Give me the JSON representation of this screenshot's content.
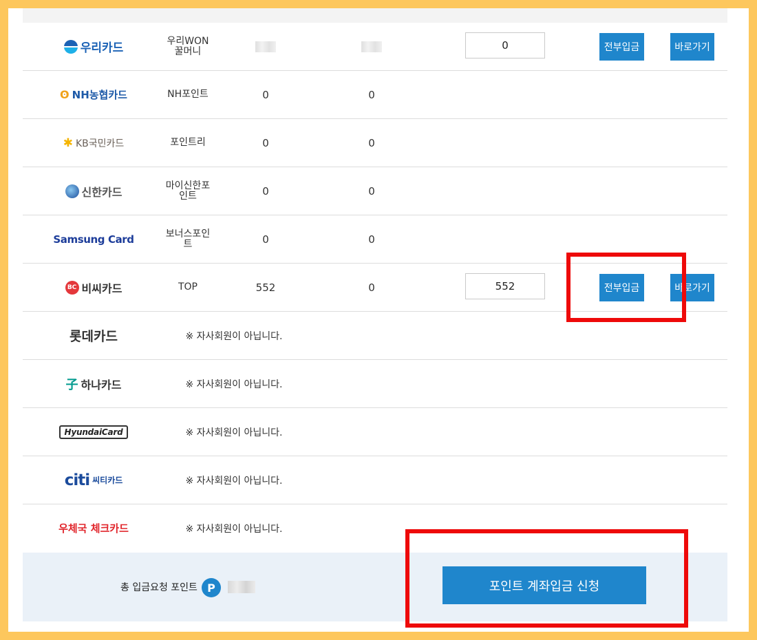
{
  "rows": [
    {
      "logo_text": "우리카드",
      "name": "우리WON\n꿀머니",
      "v1_hidden": true,
      "v2_hidden": true,
      "input_value": "0",
      "btn_all": "전부입금",
      "btn_go": "바로가기"
    },
    {
      "logo_mark": "ʘ",
      "logo_text": "NH농협카드",
      "name": "NH포인트",
      "v1": "0",
      "v2": "0"
    },
    {
      "logo_mark": "✱",
      "logo_text": "KB국민카드",
      "name": "포인트리",
      "v1": "0",
      "v2": "0"
    },
    {
      "logo_text": "신한카드",
      "name": "마이신한포\n인트",
      "v1": "0",
      "v2": "0"
    },
    {
      "logo_text": "Samsung Card",
      "name": "보너스포인\n트",
      "v1": "0",
      "v2": "0"
    },
    {
      "logo_mark": "BC",
      "logo_text": "비씨카드",
      "name": "TOP",
      "v1": "552",
      "v2": "0",
      "input_value": "552",
      "btn_all": "전부입금",
      "btn_go": "바로가기"
    },
    {
      "logo_text": "롯데카드",
      "notice": "※ 자사회원이 아닙니다."
    },
    {
      "logo_mark": "子",
      "logo_text": "하나카드",
      "notice": "※ 자사회원이 아닙니다."
    },
    {
      "logo_text": "HyundaiCard",
      "notice": "※ 자사회원이 아닙니다."
    },
    {
      "logo_mark": "citi",
      "logo_text": "씨티카드",
      "notice": "※ 자사회원이 아닙니다."
    },
    {
      "logo_text": "우체국 체크카드",
      "notice": "※ 자사회원이 아닙니다."
    }
  ],
  "summary": {
    "label": "총 입금요청 포인트",
    "p_icon": "P",
    "apply_button": "포인트 계좌입금 신청"
  },
  "colors": {
    "accent": "#1f86cc",
    "highlight": "#ee0a0a",
    "frame": "#fdc75d"
  }
}
